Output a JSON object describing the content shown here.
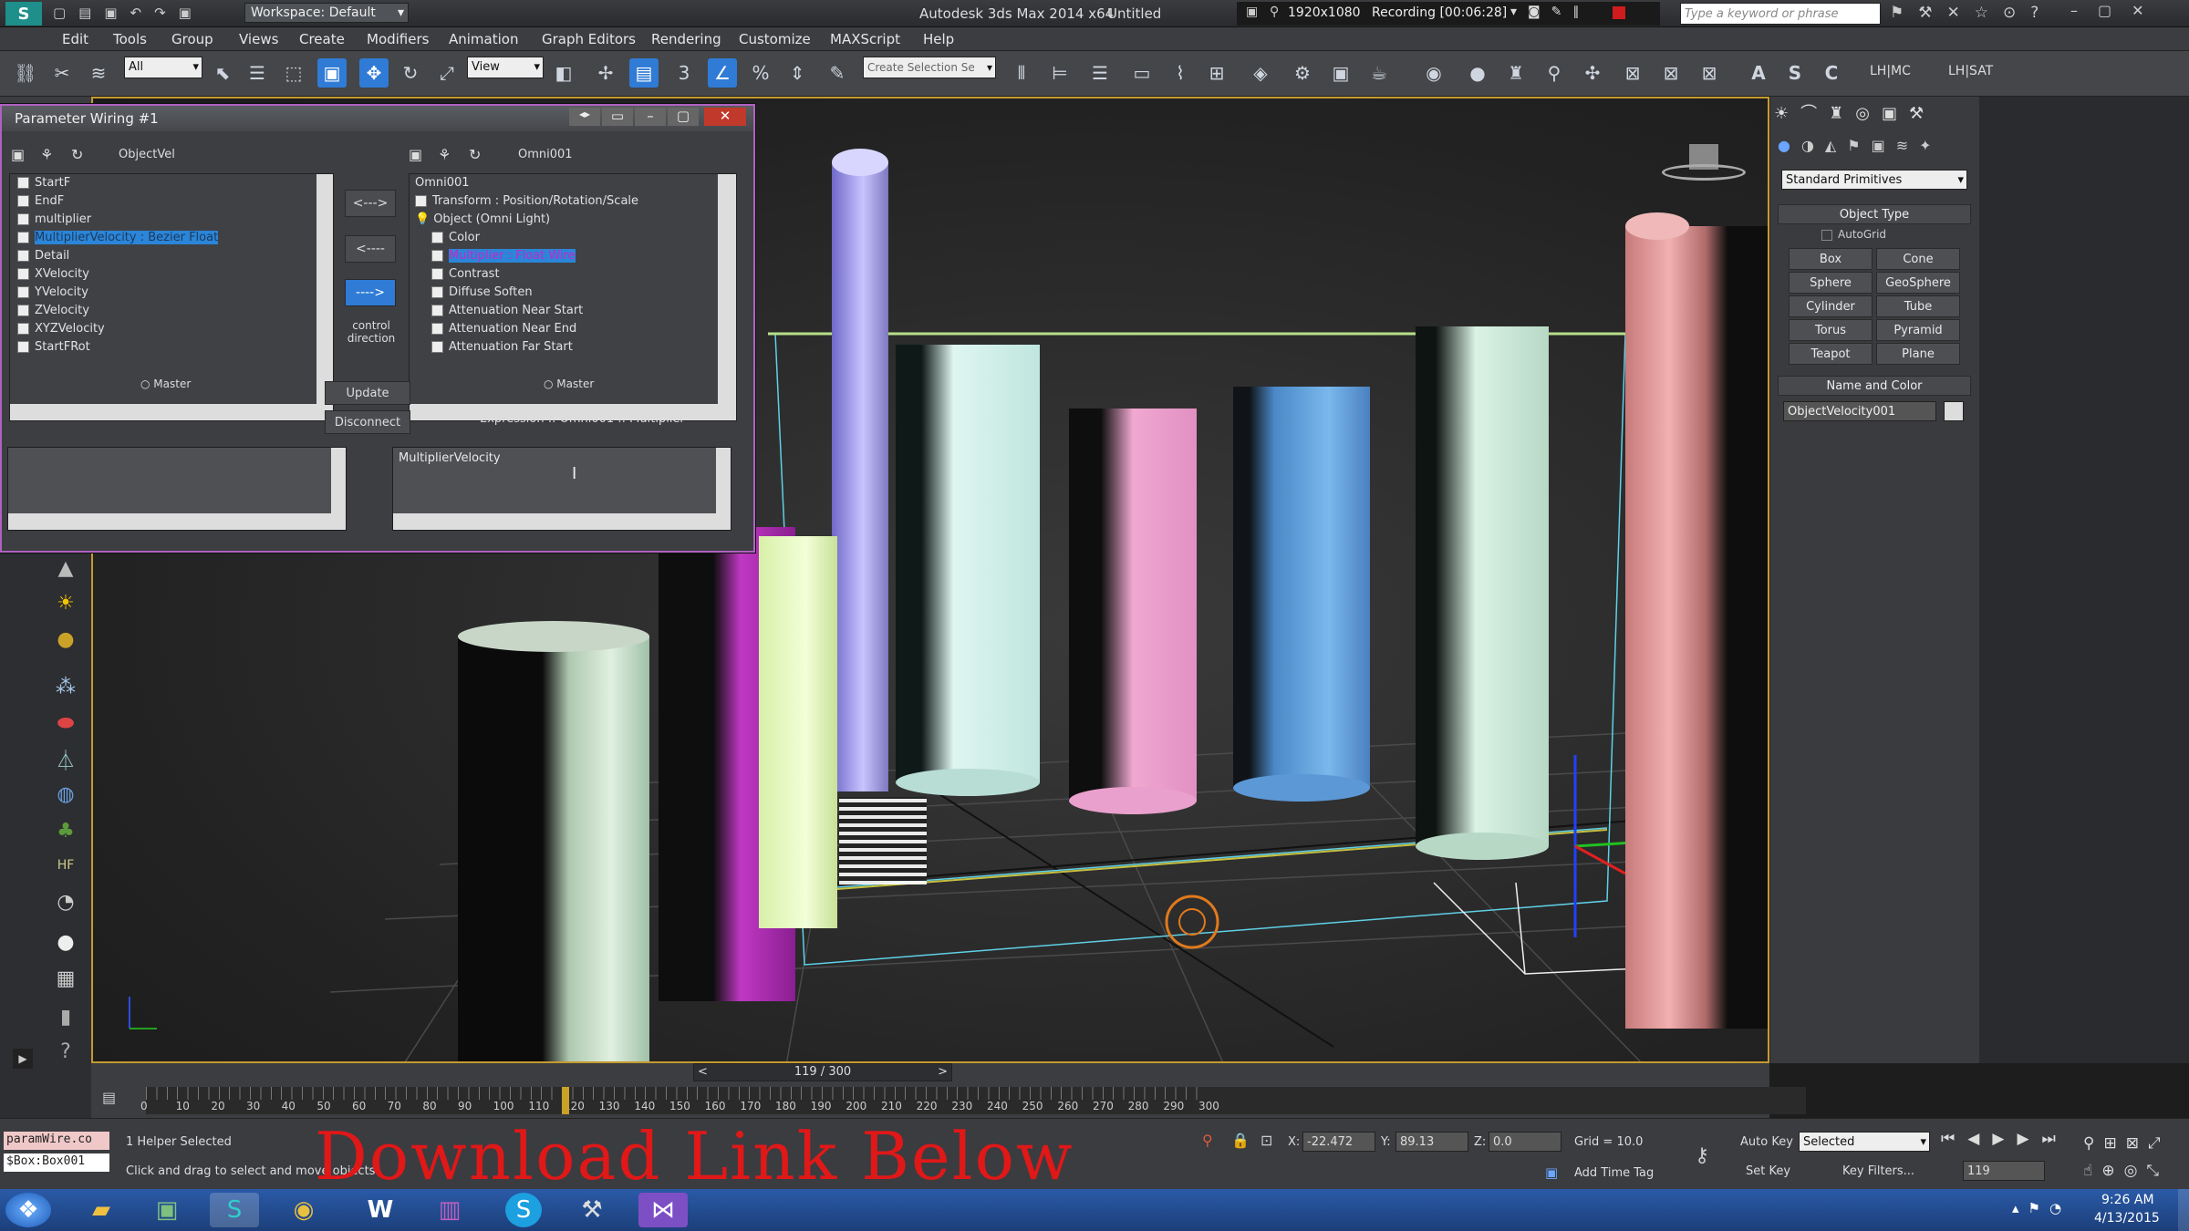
{
  "titlebar": {
    "workspace": "Workspace: Default",
    "app_title": "Autodesk 3ds Max 2014 x64",
    "doc_title": "Untitled",
    "resolution": "1920x1080",
    "recording": "Recording [00:06:28]",
    "search_placeholder": "Type a keyword or phrase"
  },
  "menu": [
    "Edit",
    "Tools",
    "Group",
    "Views",
    "Create",
    "Modifiers",
    "Animation",
    "Graph Editors",
    "Rendering",
    "Customize",
    "MAXScript",
    "Help"
  ],
  "toolbar": {
    "filter": "All",
    "ref_coord": "View",
    "selection_set": "Create Selection Se",
    "right_label1": "LH|MC",
    "right_label2": "LH|SAT"
  },
  "dialog": {
    "title": "Parameter Wiring #1",
    "left_header": "ObjectVel",
    "right_header": "Omni001",
    "left_items": [
      "StartF",
      "EndF",
      "multiplier",
      "MultiplierVelocity : Bezier Float",
      "Detail",
      "XVelocity",
      "YVelocity",
      "ZVelocity",
      "XYZVelocity",
      "StartFRot"
    ],
    "right_items": [
      "Omni001",
      "Transform : Position/Rotation/Scale",
      "Object (Omni Light)",
      "Color",
      "Multiplier : Float Wire",
      "Contrast",
      "Diffuse Soften",
      "Attenuation Near Start",
      "Attenuation Near End",
      "Attenuation Far Start"
    ],
    "arrow_right_left": "<--->",
    "arrow_left": "<----",
    "arrow_right": "---->",
    "control_direction": "control direction",
    "master_left": "Master",
    "master_right": "Master",
    "update": "Update",
    "disconnect": "Disconnect",
    "expression_label": "Expression :: Omni001 :: Multiplier",
    "expression_text": "MultiplierVelocity"
  },
  "command_panel": {
    "category": "Standard Primitives",
    "object_type": "Object Type",
    "autogrid": "AutoGrid",
    "buttons": [
      "Box",
      "Cone",
      "Sphere",
      "GeoSphere",
      "Cylinder",
      "Tube",
      "Torus",
      "Pyramid",
      "Teapot",
      "Plane"
    ],
    "name_color": "Name and Color",
    "object_name": "ObjectVelocity001"
  },
  "timeline": {
    "frame_display": "119 / 300",
    "ticks": [
      "0",
      "10",
      "20",
      "30",
      "40",
      "50",
      "60",
      "70",
      "80",
      "90",
      "100",
      "110",
      "120",
      "130",
      "140",
      "150",
      "160",
      "170",
      "180",
      "190",
      "200",
      "210",
      "220",
      "230",
      "240",
      "250",
      "260",
      "270",
      "280",
      "290",
      "300"
    ],
    "current_frame": 119,
    "total_frames": 300
  },
  "status": {
    "script1": "paramWire.co",
    "script2": "$Box:Box001",
    "selected": "1 Helper Selected",
    "prompt": "Click and drag to select and move objects",
    "x_label": "X:",
    "x": "-22.472",
    "y_label": "Y:",
    "y": "89.13",
    "z_label": "Z:",
    "z": "0.0",
    "grid": "Grid = 10.0",
    "auto_key": "Auto Key",
    "set_key": "Set Key",
    "key_mode": "Selected",
    "key_filters": "Key Filters...",
    "add_time_tag": "Add Time Tag",
    "frame": "119"
  },
  "overlay": {
    "download": "Download Link Below"
  },
  "clock": {
    "time": "9:26 AM",
    "date": "4/13/2015"
  },
  "colors": {
    "accent": "#2f7bd6",
    "dialog_border": "#b061c2",
    "viewport_border": "#c59a2f",
    "download": "#e01818"
  }
}
